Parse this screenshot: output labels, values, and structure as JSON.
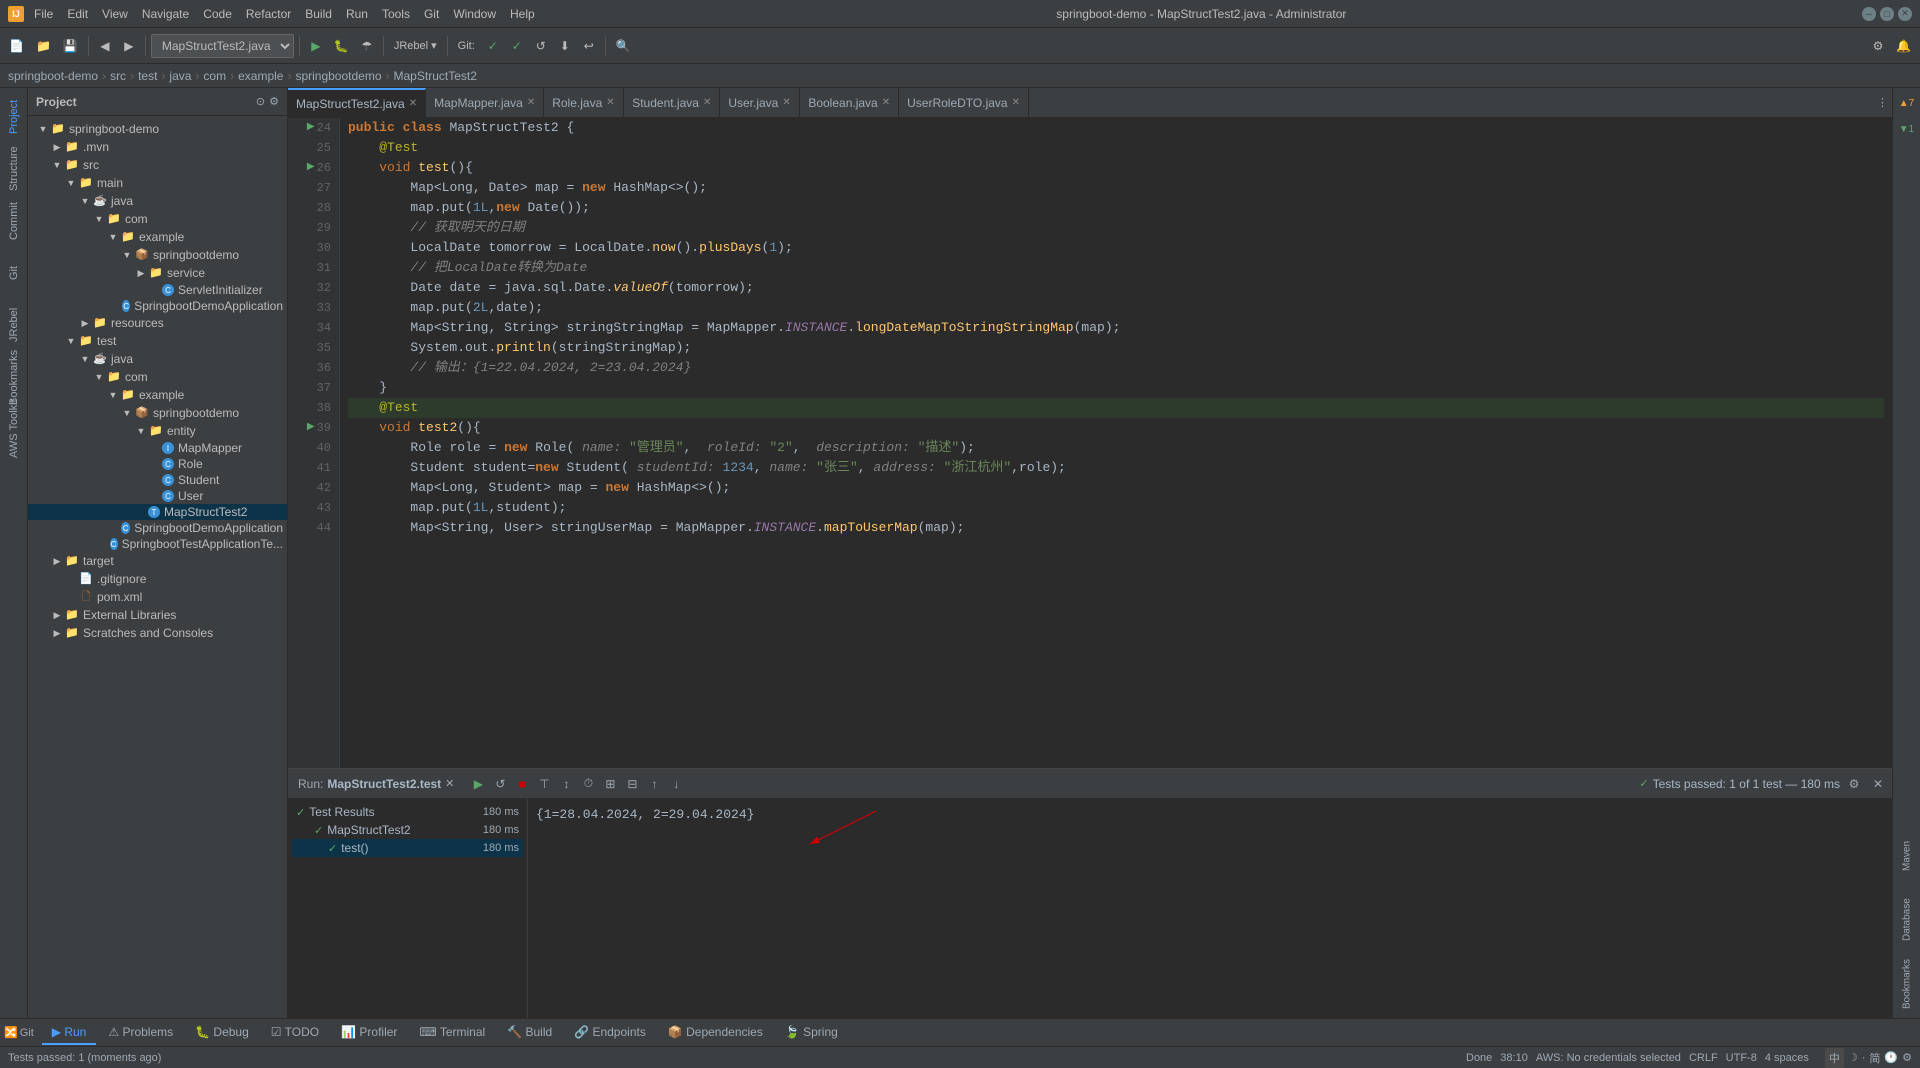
{
  "titlebar": {
    "title": "springboot-demo - MapStructTest2.java - Administrator",
    "app_label": "IJ",
    "menu": [
      "File",
      "Edit",
      "View",
      "Navigate",
      "Code",
      "Refactor",
      "Build",
      "Run",
      "Tools",
      "Git",
      "Window",
      "Help"
    ]
  },
  "toolbar": {
    "dropdown_file": "MapStructTest2.java",
    "jrebel": "JRebel ▾",
    "git": "Git:"
  },
  "breadcrumb": {
    "parts": [
      "springboot-demo",
      "src",
      "test",
      "java",
      "com",
      "example",
      "springbootdemo",
      "MapStructTest2"
    ]
  },
  "tabs": [
    {
      "label": "MapStructTest2.java",
      "active": true,
      "modified": false
    },
    {
      "label": "MapMapper.java",
      "active": false,
      "modified": false
    },
    {
      "label": "Role.java",
      "active": false,
      "modified": false
    },
    {
      "label": "Student.java",
      "active": false,
      "modified": false
    },
    {
      "label": "User.java",
      "active": false,
      "modified": false
    },
    {
      "label": "Boolean.java",
      "active": false,
      "modified": false
    },
    {
      "label": "UserRoleDTO.java",
      "active": false,
      "modified": false
    }
  ],
  "code": {
    "lines": [
      {
        "num": "24",
        "content": "    public class MapStructTest2 {",
        "gutter": ""
      },
      {
        "num": "25",
        "content": "        @Test",
        "gutter": ""
      },
      {
        "num": "26",
        "content": "        void test(){",
        "gutter": "run"
      },
      {
        "num": "27",
        "content": "            Map<Long, Date> map = new HashMap<>();",
        "gutter": ""
      },
      {
        "num": "28",
        "content": "            map.put(1L,new Date());",
        "gutter": ""
      },
      {
        "num": "29",
        "content": "            // 获取明天的日期",
        "gutter": ""
      },
      {
        "num": "30",
        "content": "            LocalDate tomorrow = LocalDate.now().plusDays(1);",
        "gutter": ""
      },
      {
        "num": "31",
        "content": "            // 把LocalDate转换为Date",
        "gutter": ""
      },
      {
        "num": "32",
        "content": "            Date date = java.sql.Date.valueOf(tomorrow);",
        "gutter": ""
      },
      {
        "num": "33",
        "content": "            map.put(2L,date);",
        "gutter": ""
      },
      {
        "num": "34",
        "content": "            Map<String, String> stringStringMap = MapMapper.INSTANCE.longDateMapToStringStringMap(map);",
        "gutter": ""
      },
      {
        "num": "35",
        "content": "            System.out.println(stringStringMap);",
        "gutter": ""
      },
      {
        "num": "36",
        "content": "            // 输出：{1=22.04.2024, 2=23.04.2024}",
        "gutter": ""
      },
      {
        "num": "37",
        "content": "        }",
        "gutter": ""
      },
      {
        "num": "38",
        "content": "        @Test",
        "gutter": ""
      },
      {
        "num": "39",
        "content": "        void test2(){",
        "gutter": "run"
      },
      {
        "num": "40",
        "content": "            Role role = new Role( name: \"管理员\",  roleId: \"2\",  description: \"描述\");",
        "gutter": ""
      },
      {
        "num": "41",
        "content": "            Student student=new Student( studentId: 1234, name: \"张三\", address: \"浙江杭州\",role);",
        "gutter": ""
      },
      {
        "num": "42",
        "content": "            Map<Long, Student> map = new HashMap<>();",
        "gutter": ""
      },
      {
        "num": "43",
        "content": "            map.put(1L,student);",
        "gutter": ""
      },
      {
        "num": "44",
        "content": "            Map<String, User> stringUserMap = MapMapper.INSTANCE.mapToUserMap(map);",
        "gutter": ""
      }
    ]
  },
  "sidebar": {
    "title": "Project",
    "tree": [
      {
        "label": ".mvn",
        "indent": 1,
        "type": "folder",
        "expanded": false
      },
      {
        "label": "src",
        "indent": 1,
        "type": "folder",
        "expanded": true
      },
      {
        "label": "main",
        "indent": 2,
        "type": "folder",
        "expanded": true
      },
      {
        "label": "java",
        "indent": 3,
        "type": "folder",
        "expanded": true
      },
      {
        "label": "com",
        "indent": 4,
        "type": "folder",
        "expanded": true
      },
      {
        "label": "example",
        "indent": 5,
        "type": "folder",
        "expanded": true
      },
      {
        "label": "springbootdemo",
        "indent": 6,
        "type": "package",
        "expanded": true
      },
      {
        "label": "service",
        "indent": 7,
        "type": "folder",
        "expanded": false
      },
      {
        "label": "ServletInitializer",
        "indent": 8,
        "type": "java_file"
      },
      {
        "label": "SpringbootDemoApplication",
        "indent": 8,
        "type": "java_file"
      },
      {
        "label": "resources",
        "indent": 3,
        "type": "folder",
        "expanded": false
      },
      {
        "label": "test",
        "indent": 2,
        "type": "folder",
        "expanded": true
      },
      {
        "label": "java",
        "indent": 3,
        "type": "folder",
        "expanded": true
      },
      {
        "label": "com",
        "indent": 4,
        "type": "folder",
        "expanded": true
      },
      {
        "label": "example",
        "indent": 5,
        "type": "folder",
        "expanded": true
      },
      {
        "label": "springbootdemo",
        "indent": 6,
        "type": "package",
        "expanded": true
      },
      {
        "label": "entity",
        "indent": 7,
        "type": "folder",
        "expanded": true
      },
      {
        "label": "MapMapper",
        "indent": 8,
        "type": "java_file"
      },
      {
        "label": "Role",
        "indent": 8,
        "type": "java_file"
      },
      {
        "label": "Student",
        "indent": 8,
        "type": "java_file"
      },
      {
        "label": "User",
        "indent": 8,
        "type": "java_file"
      },
      {
        "label": "MapStructTest2",
        "indent": 7,
        "type": "java_file",
        "selected": true
      },
      {
        "label": "SpringbootDemoApplication",
        "indent": 7,
        "type": "java_file"
      },
      {
        "label": "SpringbootTestApplicationTe...",
        "indent": 7,
        "type": "java_file"
      },
      {
        "label": "target",
        "indent": 1,
        "type": "folder",
        "expanded": false
      },
      {
        "label": ".gitignore",
        "indent": 2,
        "type": "file"
      },
      {
        "label": "pom.xml",
        "indent": 2,
        "type": "xml_file"
      },
      {
        "label": "External Libraries",
        "indent": 1,
        "type": "folder",
        "expanded": false
      },
      {
        "label": "Scratches and Consoles",
        "indent": 1,
        "type": "folder",
        "expanded": false
      }
    ]
  },
  "bottom": {
    "run_title": "Run:",
    "run_tab": "MapStructTest2.test",
    "test_status": "Tests passed: 1 of 1 test — 180 ms",
    "test_results_label": "Test Results",
    "test_results_time": "180 ms",
    "test_class_label": "MapStructTest2",
    "test_class_time": "180 ms",
    "test_method_label": "test()",
    "test_method_time": "180 ms",
    "output_text": "{1=28.04.2024, 2=29.04.2024}"
  },
  "status_bar": {
    "left_text": "Tests passed: 1 (moments ago)",
    "right_items": [
      "Done",
      "38:10",
      "AWS: No credentials selected",
      "CRLF",
      "UTF-8",
      "4 spaces"
    ]
  },
  "bottombar_tabs": [
    "Run",
    "Git",
    "Problems",
    "Debug",
    "TODO",
    "Profiler",
    "Terminal",
    "Build",
    "Endpoints",
    "Dependencies",
    "Spring"
  ],
  "right_panel_labels": [
    "Maven",
    "Database",
    "Bookmarks"
  ],
  "left_panel_labels": [
    "Project",
    "Structure",
    "Commit",
    "Git",
    "JRebel",
    "Bookmarks",
    "AWS Toolkit"
  ]
}
